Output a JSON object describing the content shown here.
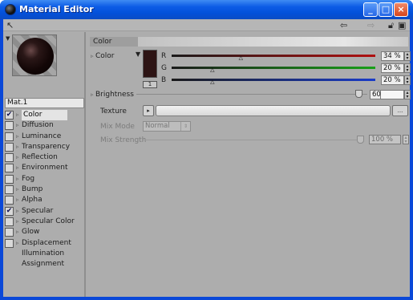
{
  "window": {
    "title": "Material Editor",
    "buttons": {
      "minimize": "_",
      "maximize": "□",
      "close": "×"
    }
  },
  "toolbar": {
    "left_icon": "pointer-tool-icon",
    "right_icons": [
      "back-arrow-icon",
      "forward-arrow-icon",
      "lock-icon",
      "window-icon"
    ]
  },
  "material": {
    "name": "Mat.1",
    "preview_color": "#2d1414"
  },
  "channels": [
    {
      "label": "Color",
      "checked": true,
      "selected": true,
      "has_checkbox": true
    },
    {
      "label": "Diffusion",
      "checked": false,
      "has_checkbox": true
    },
    {
      "label": "Luminance",
      "checked": false,
      "has_checkbox": true
    },
    {
      "label": "Transparency",
      "checked": false,
      "has_checkbox": true
    },
    {
      "label": "Reflection",
      "checked": false,
      "has_checkbox": true
    },
    {
      "label": "Environment",
      "checked": false,
      "has_checkbox": true
    },
    {
      "label": "Fog",
      "checked": false,
      "has_checkbox": true
    },
    {
      "label": "Bump",
      "checked": false,
      "has_checkbox": true
    },
    {
      "label": "Alpha",
      "checked": false,
      "has_checkbox": true
    },
    {
      "label": "Specular",
      "checked": true,
      "has_checkbox": true
    },
    {
      "label": "Specular Color",
      "checked": false,
      "has_checkbox": true
    },
    {
      "label": "Glow",
      "checked": false,
      "has_checkbox": true
    },
    {
      "label": "Displacement",
      "checked": false,
      "has_checkbox": true
    },
    {
      "label": "Illumination",
      "has_checkbox": false
    },
    {
      "label": "Assignment",
      "has_checkbox": false
    }
  ],
  "color_section": {
    "title": "Color",
    "color_label": "Color",
    "r": {
      "label": "R",
      "value": "34 %",
      "level": 34,
      "color": "#b01010"
    },
    "g": {
      "label": "G",
      "value": "20 %",
      "level": 20,
      "color": "#18a018"
    },
    "b": {
      "label": "B",
      "value": "20 %",
      "level": 20,
      "color": "#1a3cc8"
    },
    "brightness_label": "Brightness",
    "brightness_value": "60",
    "brightness_level": 60,
    "texture_label": "Texture",
    "texture_button": "...",
    "mix_mode_label": "Mix Mode",
    "mix_mode_value": "Normal",
    "mix_strength_label": "Mix Strength",
    "mix_strength_value": "100 %"
  }
}
